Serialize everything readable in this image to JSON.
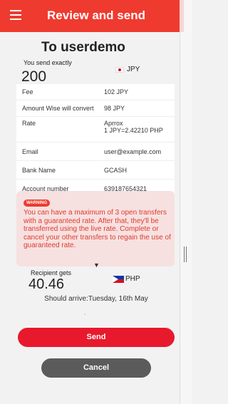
{
  "header": {
    "title": "Review and send",
    "color": "#ef3a2f"
  },
  "summary": {
    "title": "To userdemo",
    "send_label": "You send exactly",
    "send_amount": "200",
    "send_currency": "JPY"
  },
  "details": [
    {
      "label": "Fee",
      "value": "102 JPY"
    },
    {
      "label": "Amount Wise will convert",
      "value": "98 JPY"
    },
    {
      "label": "Rate",
      "value": "Aprrox",
      "value2": "1 JPY=2.42210 PHP"
    },
    {
      "label": "Email",
      "value": "user@example.com"
    },
    {
      "label": "Bank Name",
      "value": "GCASH"
    },
    {
      "label": "Account number",
      "value": "639187654321"
    }
  ],
  "warning": {
    "badge": "WARNING",
    "text": "You can have a maximum of 3 open transfers with a guaranteed rate. After that, they'll be transferred using the live rate. Complete or cancel your other transfers to regain the use of guaranteed rate."
  },
  "recipient": {
    "label": "Recipient gets",
    "amount": "40.46",
    "currency": "PHP",
    "arrival": "Should arrive:Tuesday, 16th May"
  },
  "actions": {
    "send": "Send",
    "cancel": "Cancel"
  },
  "colors": {
    "accent": "#e8192c",
    "cancel": "#5b5b5b",
    "warning_bg": "#f6e1e0"
  }
}
